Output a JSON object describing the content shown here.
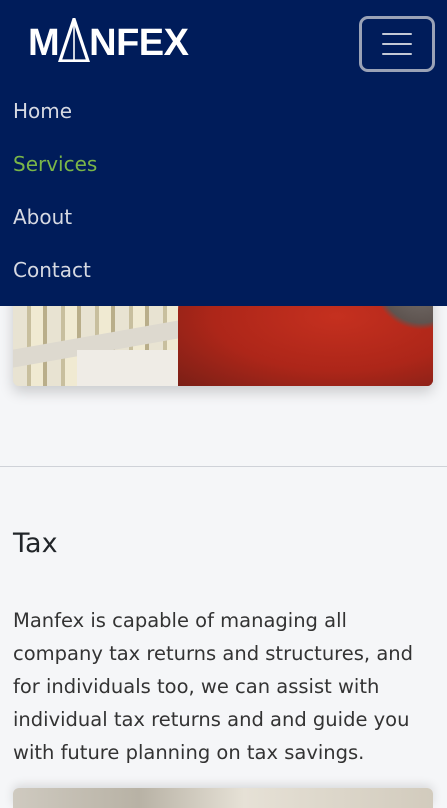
{
  "brand": {
    "logo_text": "MANFEX",
    "logo_prefix": "M",
    "logo_suffix": "NFEX"
  },
  "navbar": {
    "toggler_icon": "hamburger-icon",
    "background": "#001c5a",
    "active_color": "#7ab648",
    "items": [
      {
        "label": "Home",
        "active": false
      },
      {
        "label": "Services",
        "active": true
      },
      {
        "label": "About",
        "active": false
      },
      {
        "label": "Contact",
        "active": false
      }
    ]
  },
  "section": {
    "title": "Tax",
    "body": "Manfex is capable of managing all company tax returns and structures, and for individuals too, we can assist with individual tax returns and and guide you with future planning on tax savings."
  }
}
